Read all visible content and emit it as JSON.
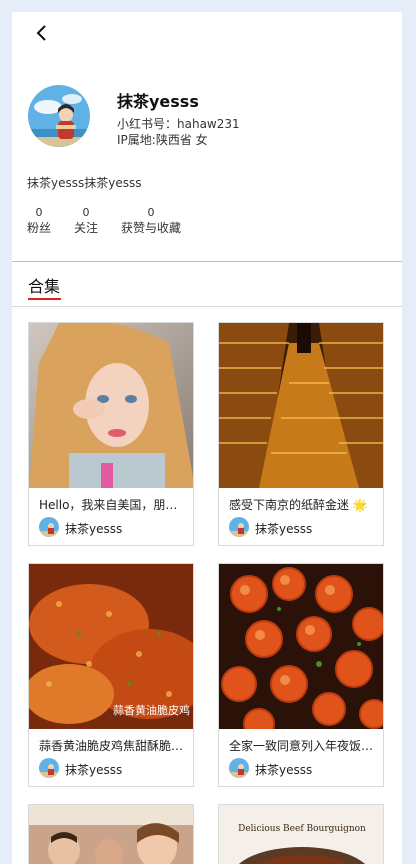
{
  "profile": {
    "name": "抹茶yesss",
    "red_id": "小红书号：hahaw231",
    "ip_gender": "IP属地:陕西省 女",
    "bio": "抹茶yesss抹茶yesss"
  },
  "stats": [
    {
      "value": "0",
      "label": "粉丝"
    },
    {
      "value": "0",
      "label": "关注"
    },
    {
      "value": "0",
      "label": "获赞与收藏"
    }
  ],
  "tabs": [
    {
      "label": "合集",
      "active": true
    }
  ],
  "cards": [
    {
      "title": "Hello，我来自美国，朋友们都叫我小...",
      "author": "抹茶yesss"
    },
    {
      "title": "感受下南京的纸醉金迷 🌟",
      "author": "抹茶yesss"
    },
    {
      "title": "蒜香黄油脆皮鸡焦甜酥脆 🍗",
      "author": "抹茶yesss",
      "overlay": "蒜香黄油脆皮鸡"
    },
    {
      "title": "全家一致同意列入年夜饭的虾",
      "author": "抹茶yesss"
    },
    {
      "title": "",
      "author": ""
    },
    {
      "title": "",
      "author": "",
      "overlay": "Delicious Beef Bourguignon"
    }
  ],
  "colors": {
    "accent": "#e0221f",
    "background": "#e7edf8"
  },
  "icons": {
    "back": "chevron-left-icon"
  }
}
